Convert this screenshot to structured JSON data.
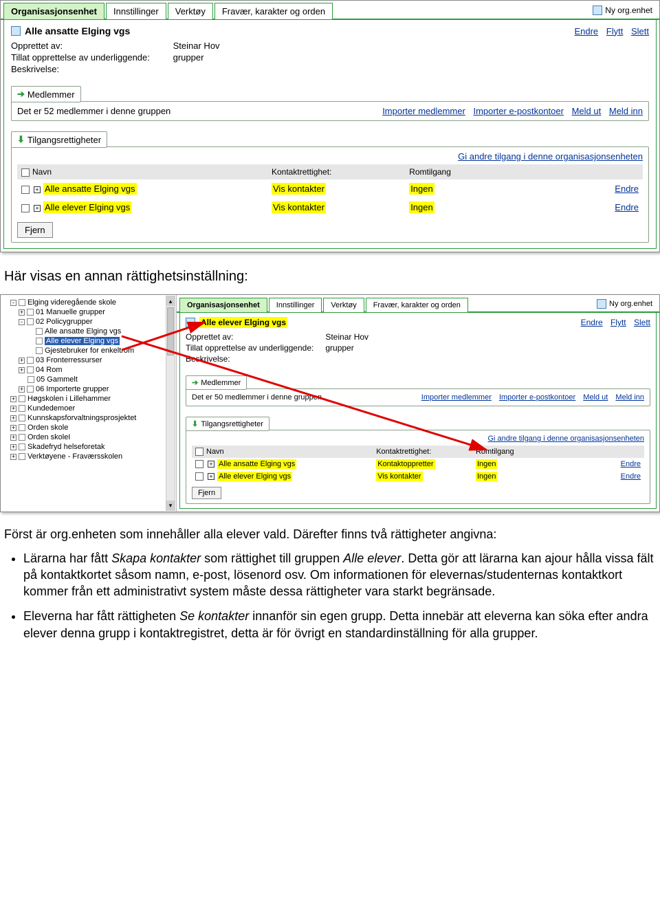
{
  "screenshot1": {
    "tabs": [
      "Organisasjonsenhet",
      "Innstillinger",
      "Verktøy",
      "Fravær, karakter og orden"
    ],
    "nyOrg": "Ny org.enhet",
    "title": "Alle ansatte Elging vgs",
    "actions": [
      "Endre",
      "Flytt",
      "Slett"
    ],
    "meta": {
      "createdByLabel": "Opprettet av:",
      "createdBy": "Steinar Hov",
      "allowLabel": "Tillat opprettelse av underliggende:",
      "allow": "grupper",
      "descLabel": "Beskrivelse:"
    },
    "members": {
      "tabLabel": "Medlemmer",
      "countText": "Det er 52 medlemmer i denne gruppen",
      "links": [
        "Importer medlemmer",
        "Importer e-postkontoer",
        "Meld ut",
        "Meld inn"
      ]
    },
    "tilgang": {
      "tabLabel": "Tilgangsrettigheter",
      "topLink": "Gi andre tilgang i denne organisasjonsenheten",
      "headers": [
        "Navn",
        "Kontaktrettighet:",
        "Romtilgang",
        ""
      ],
      "rows": [
        {
          "name": "Alle ansatte Elging vgs",
          "kontakt": "Vis kontakter",
          "rom": "Ingen",
          "action": "Endre"
        },
        {
          "name": "Alle elever Elging vgs",
          "kontakt": "Vis kontakter",
          "rom": "Ingen",
          "action": "Endre"
        }
      ],
      "removeBtn": "Fjern"
    }
  },
  "heading1": "Här visas en annan rättighetsinställning:",
  "screenshot2": {
    "tree": [
      {
        "ind": 0,
        "tog": "-",
        "label": "Elging videregående skole"
      },
      {
        "ind": 1,
        "tog": "+",
        "label": "01 Manuelle grupper"
      },
      {
        "ind": 1,
        "tog": "-",
        "label": "02 Policygrupper"
      },
      {
        "ind": 2,
        "tog": "",
        "label": "Alle ansatte Elging vgs"
      },
      {
        "ind": 2,
        "tog": "",
        "label": "Alle elever Elging vgs",
        "selected": true
      },
      {
        "ind": 2,
        "tog": "",
        "label": "Gjestebruker for enkeltrom"
      },
      {
        "ind": 1,
        "tog": "+",
        "label": "03 Fronterressurser"
      },
      {
        "ind": 1,
        "tog": "+",
        "label": "04 Rom"
      },
      {
        "ind": 1,
        "tog": "",
        "label": "05 Gammelt"
      },
      {
        "ind": 1,
        "tog": "+",
        "label": "06 Importerte grupper"
      },
      {
        "ind": 0,
        "tog": "+",
        "label": "Høgskolen i Lillehammer"
      },
      {
        "ind": 0,
        "tog": "+",
        "label": "Kundedemoer"
      },
      {
        "ind": 0,
        "tog": "+",
        "label": "Kunnskapsforvaltningsprosjektet"
      },
      {
        "ind": 0,
        "tog": "+",
        "label": "Orden skole"
      },
      {
        "ind": 0,
        "tog": "+",
        "label": "Orden skoleI"
      },
      {
        "ind": 0,
        "tog": "+",
        "label": "Skadefryd helseforetak"
      },
      {
        "ind": 0,
        "tog": "+",
        "label": "Verktøyene - Fraværsskolen"
      }
    ],
    "tabs": [
      "Organisasjonsenhet",
      "Innstillinger",
      "Verktøy",
      "Fravær, karakter og orden"
    ],
    "nyOrg": "Ny org.enhet",
    "title": "Alle elever Elging vgs",
    "actions": [
      "Endre",
      "Flytt",
      "Slett"
    ],
    "meta": {
      "createdByLabel": "Opprettet av:",
      "createdBy": "Steinar Hov",
      "allowLabel": "Tillat opprettelse av underliggende:",
      "allow": "grupper",
      "descLabel": "Beskrivelse:"
    },
    "members": {
      "tabLabel": "Medlemmer",
      "countText": "Det er 50 medlemmer i denne gruppen",
      "links": [
        "Importer medlemmer",
        "Importer e-postkontoer",
        "Meld ut",
        "Meld inn"
      ]
    },
    "tilgang": {
      "tabLabel": "Tilgangsrettigheter",
      "topLink": "Gi andre tilgang i denne organisasjonsenheten",
      "headers": [
        "Navn",
        "Kontaktrettighet:",
        "Romtilgang",
        ""
      ],
      "rows": [
        {
          "name": "Alle ansatte Elging vgs",
          "kontakt": "Kontaktoppretter",
          "rom": "Ingen",
          "action": "Endre"
        },
        {
          "name": "Alle elever Elging vgs",
          "kontakt": "Vis kontakter",
          "rom": "Ingen",
          "action": "Endre"
        }
      ],
      "removeBtn": "Fjern"
    }
  },
  "para1": "Först är org.enheten som innehåller alla elever vald. Därefter finns två rättigheter angivna:",
  "bullets": [
    {
      "pre": "Lärarna har fått ",
      "em1": "Skapa kontakter",
      "mid": " som rättighet till gruppen ",
      "em2": "Alle elever",
      "post": ". Detta gör att lärarna kan ajour hålla vissa fält på kontaktkortet såsom namn, e-post, lösenord osv. Om informationen för elevernas/studenternas kontaktkort kommer från ett administrativt system måste dessa rättigheter vara starkt begränsade."
    },
    {
      "pre": "Eleverna har fått rättigheten ",
      "em1": "Se kontakter",
      "mid": " innanför sin egen grupp. ",
      "em2": "",
      "post": "Detta innebär att eleverna kan söka efter andra elever denna grupp i kontaktregistret, detta är för övrigt en standardinställning för alla grupper."
    }
  ]
}
